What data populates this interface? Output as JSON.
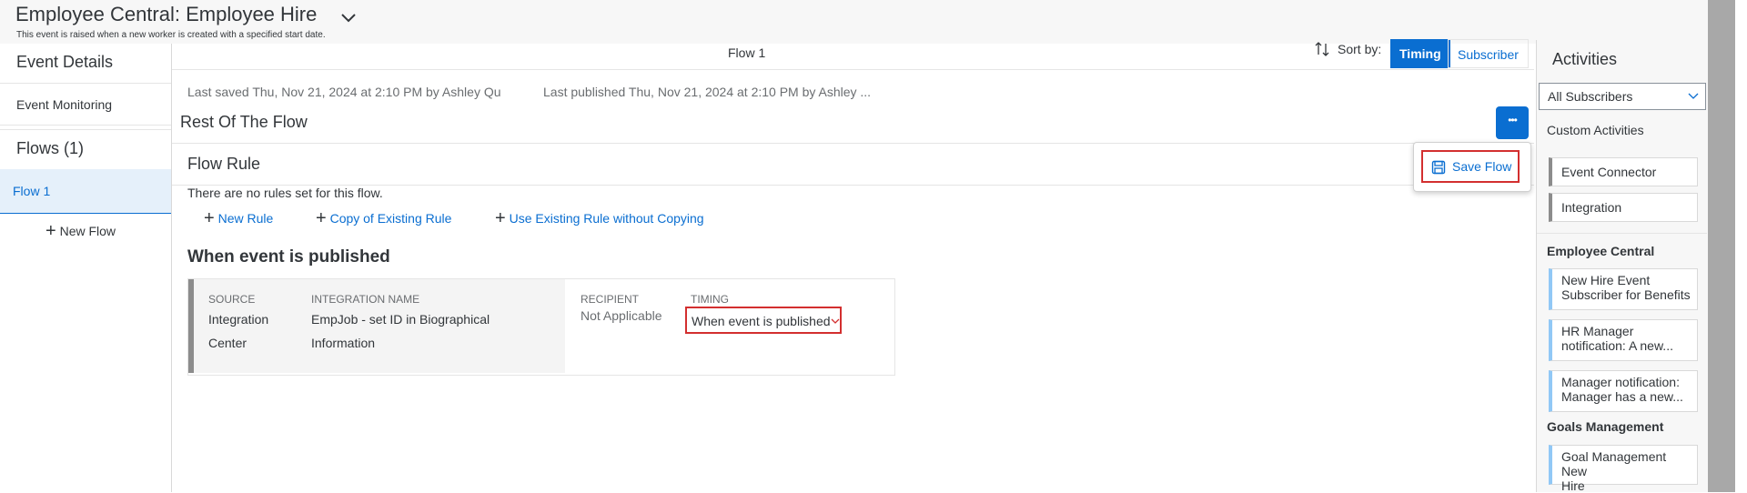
{
  "header": {
    "title": "Employee Central: Employee Hire",
    "subtitle": "This event is raised when a new worker is created with a specified start date."
  },
  "left_nav": {
    "event_details": "Event Details",
    "event_monitoring": "Event Monitoring",
    "flows_heading": "Flows (1)",
    "flow_item": "Flow 1",
    "new_flow": "New Flow"
  },
  "tabs": {
    "current": "Flow 1",
    "sort_label": "Sort by:",
    "sort_options": [
      "Timing",
      "Subscriber"
    ],
    "sort_selected": "Timing"
  },
  "flow": {
    "last_saved": "Last saved Thu, Nov 21, 2024 at 2:10 PM by Ashley Qu",
    "last_published": "Last published Thu, Nov 21, 2024 at 2:10 PM by Ashley ...",
    "section_title": "Rest Of The Flow",
    "menu_button": "•••",
    "save_flow": "Save Flow",
    "rule_heading": "Flow Rule",
    "no_rules": "There are no rules set for this flow.",
    "actions": [
      "New Rule",
      "Copy of Existing Rule",
      "Use Existing Rule without Copying"
    ],
    "event_heading": "When event is published"
  },
  "subscriber_card": {
    "source_label": "SOURCE",
    "source_value_1": "Integration",
    "source_value_2": "Center",
    "integration_label": "INTEGRATION NAME",
    "integration_value_1": "EmpJob - set ID in Biographical",
    "integration_value_2": "Information",
    "recipient_label": "RECIPIENT",
    "recipient_value": "Not Applicable",
    "timing_label": "TIMING",
    "timing_value": "When event is published"
  },
  "activities": {
    "title": "Activities",
    "filter": "All Subscribers",
    "custom_heading": "Custom Activities",
    "custom": [
      "Event Connector",
      "Integration"
    ],
    "groups": [
      {
        "heading": "Employee Central",
        "items": [
          [
            "New Hire Event",
            "Subscriber for Benefits"
          ],
          [
            "HR Manager",
            "notification: A new..."
          ],
          [
            "Manager notification:",
            "Manager has a new..."
          ]
        ]
      },
      {
        "heading": "Goals Management",
        "items": [
          [
            "Goal Management New",
            "Hire"
          ]
        ]
      }
    ]
  },
  "colors": {
    "accent": "#0a6ed1",
    "highlight": "#d32f2f"
  }
}
